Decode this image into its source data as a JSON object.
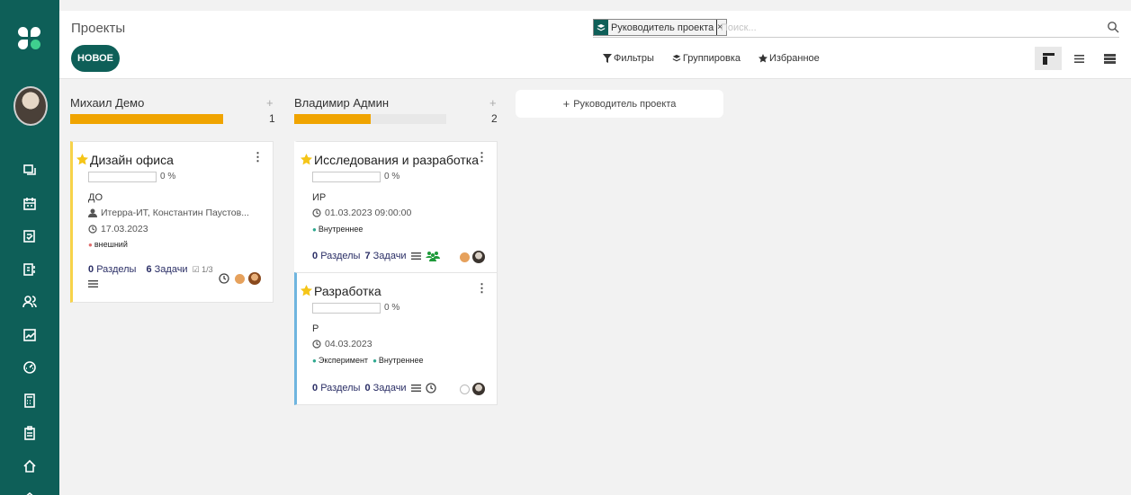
{
  "app": {
    "title": "Проекты",
    "new_label": "НОВОЕ"
  },
  "search": {
    "facet_label": "Руководитель проекта",
    "facet_close": "×",
    "placeholder": "Поиск..."
  },
  "toolbar": {
    "filters": "Фильтры",
    "group": "Группировка",
    "favorites": "Избранное"
  },
  "columns": [
    {
      "name": "Михаил Демо",
      "count": "1",
      "progress_fraction": 1.0,
      "plus": "+"
    },
    {
      "name": "Владимир Админ",
      "count": "2",
      "progress_fraction": 0.5,
      "plus": "+"
    }
  ],
  "add_column_label": "Руководитель проекта",
  "cards": [
    {
      "title": "Дизайн офиса",
      "progress": "0 %",
      "code": "ДО",
      "partner": "Итерра-ИТ, Константин Паустов...",
      "date": "17.03.2023",
      "tags": [
        "внешний"
      ],
      "sections_count": "0",
      "sections_label": "Разделы",
      "tasks_count": "6",
      "tasks_label": "Задачи",
      "checks": "1/3"
    },
    {
      "title": "Исследования и разработка",
      "progress": "0 %",
      "code": "ИР",
      "date": "01.03.2023 09:00:00",
      "tags": [
        "Внутреннее"
      ],
      "sections_count": "0",
      "sections_label": "Разделы",
      "tasks_count": "7",
      "tasks_label": "Задачи"
    },
    {
      "title": "Разработка",
      "progress": "0 %",
      "code": "Р",
      "date": "04.03.2023",
      "tags": [
        "Эксперимент",
        "Внутреннее"
      ],
      "sections_count": "0",
      "sections_label": "Разделы",
      "tasks_count": "0",
      "tasks_label": "Задачи"
    }
  ],
  "colors": {
    "brand": "#0e5f58",
    "progress": "#f0a400",
    "star": "#f5c518",
    "tag_red": "#e06b6b",
    "tag_teal": "#2fa88f",
    "stats_text": "#2b2f66"
  },
  "sidebar_icons": [
    "discuss-icon",
    "calendar-icon",
    "notes-icon",
    "contacts-icon",
    "users-icon",
    "chart-icon",
    "dashboard-icon",
    "calculator-icon",
    "clipboard-icon",
    "home-icon",
    "home-settings-icon"
  ]
}
